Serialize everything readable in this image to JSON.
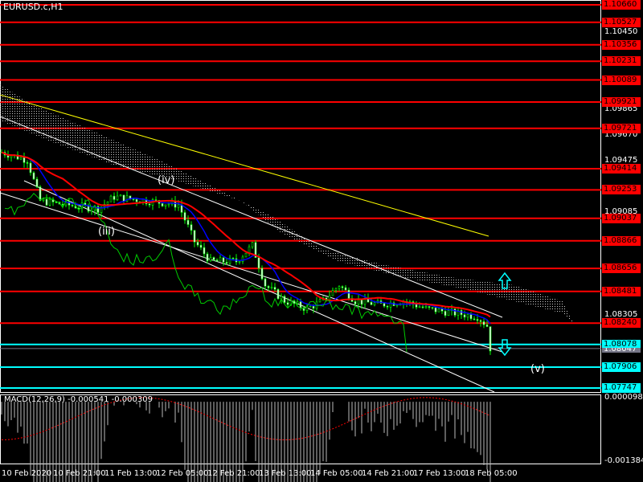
{
  "symbol_title": "EURUSD.c,H1",
  "macd_title": "MACD(12,26,9) -0.000541 -0.000309",
  "wave_labels": {
    "iii": "(iii)",
    "iv": "(iv)",
    "v": "(v)"
  },
  "colors": {
    "resistance": "#ff0000",
    "support": "#00ffff",
    "candles": "#00ff00",
    "ma_fast": "#ff0000",
    "ma_slow": "#0000ff",
    "trendline": "#ffff00",
    "channel": "#ffffff",
    "current_price": "#808080"
  },
  "price_axis": {
    "ticks": [
      "1.10450",
      "1.09865",
      "1.09670",
      "1.09475",
      "1.09085",
      "1.08305"
    ],
    "red_levels": [
      "1.10660",
      "1.10527",
      "1.10356",
      "1.10231",
      "1.10089",
      "1.09921",
      "1.09721",
      "1.09414",
      "1.09253",
      "1.09037",
      "1.08866",
      "1.08656",
      "1.08481",
      "1.08240"
    ],
    "cyan_levels": [
      "1.08078",
      "1.07906",
      "1.07747"
    ],
    "current_price": "1.08047"
  },
  "macd_axis": {
    "top": "0.000098",
    "bottom": "-0.001384"
  },
  "time_axis": [
    "10 Feb 2020",
    "10 Feb 21:00",
    "11 Feb 13:00",
    "12 Feb 05:00",
    "12 Feb 21:00",
    "13 Feb 13:00",
    "14 Feb 05:00",
    "14 Feb 21:00",
    "17 Feb 13:00",
    "18 Feb 05:00"
  ],
  "chart_data": {
    "type": "candlestick",
    "title": "EURUSD.c,H1",
    "ylim": [
      1.077,
      1.107
    ],
    "close_keypoints": [
      {
        "bar": 0,
        "price": 1.0954
      },
      {
        "bar": 8,
        "price": 1.0948
      },
      {
        "bar": 12,
        "price": 1.0917
      },
      {
        "bar": 20,
        "price": 1.0914
      },
      {
        "bar": 30,
        "price": 1.0911
      },
      {
        "bar": 35,
        "price": 1.092
      },
      {
        "bar": 45,
        "price": 1.0917
      },
      {
        "bar": 55,
        "price": 1.0914
      },
      {
        "bar": 60,
        "price": 1.0886
      },
      {
        "bar": 65,
        "price": 1.0871
      },
      {
        "bar": 73,
        "price": 1.0871
      },
      {
        "bar": 78,
        "price": 1.0883
      },
      {
        "bar": 82,
        "price": 1.0853
      },
      {
        "bar": 88,
        "price": 1.0841
      },
      {
        "bar": 95,
        "price": 1.0835
      },
      {
        "bar": 100,
        "price": 1.0841
      },
      {
        "bar": 105,
        "price": 1.0853
      },
      {
        "bar": 110,
        "price": 1.0841
      },
      {
        "bar": 118,
        "price": 1.0838
      },
      {
        "bar": 125,
        "price": 1.0841
      },
      {
        "bar": 132,
        "price": 1.0835
      },
      {
        "bar": 140,
        "price": 1.0832
      },
      {
        "bar": 148,
        "price": 1.0829
      },
      {
        "bar": 151,
        "price": 1.0822
      },
      {
        "bar": 152,
        "price": 1.0805
      }
    ]
  }
}
